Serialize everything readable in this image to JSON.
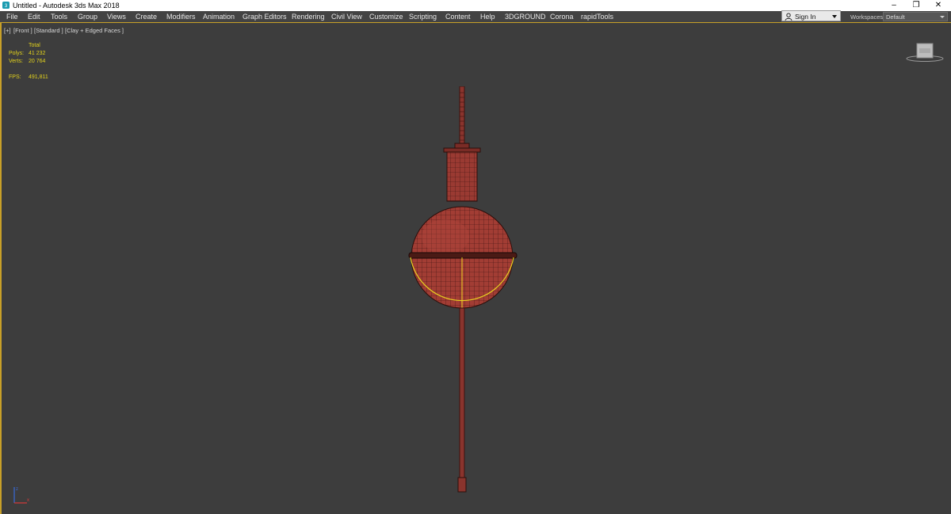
{
  "window": {
    "title": "Untitled - Autodesk 3ds Max 2018",
    "icon": "3ds-max-logo-icon",
    "controls": {
      "minimize": "–",
      "restore": "❐",
      "close": "✕"
    }
  },
  "menu": {
    "items": [
      {
        "label": "File"
      },
      {
        "label": "Edit"
      },
      {
        "label": "Tools"
      },
      {
        "label": "Group"
      },
      {
        "label": "Views"
      },
      {
        "label": "Create"
      },
      {
        "label": "Modifiers"
      },
      {
        "label": "Animation"
      },
      {
        "label": "Graph Editors"
      },
      {
        "label": "Rendering"
      },
      {
        "label": "Civil View"
      },
      {
        "label": "Customize"
      },
      {
        "label": "Scripting"
      },
      {
        "label": "Content"
      },
      {
        "label": "Help"
      },
      {
        "label": "3DGROUND"
      },
      {
        "label": "Corona"
      },
      {
        "label": "rapidTools"
      }
    ],
    "sign_in": "Sign In",
    "workspaces_label": "Workspaces:",
    "workspaces_value": "Default"
  },
  "viewport": {
    "labels": [
      "[+]",
      "[Front ]",
      "[Standard ]",
      "[Clay + Edged Faces ]"
    ],
    "stats": {
      "total_label": "Total",
      "polys_label": "Polys:",
      "polys_value": "41 232",
      "verts_label": "Verts:",
      "verts_value": "20 764",
      "fps_label": "FPS:",
      "fps_value": "491,811"
    },
    "viewcube_icon": "viewcube-icon",
    "axis_icon": "axis-tripod-icon"
  },
  "colors": {
    "accent": "#c8a028",
    "viewport_bg": "#3d3d3d",
    "stats_text": "#e2d21c",
    "model_clay": "#9a3a32",
    "selection": "#e8d020"
  }
}
